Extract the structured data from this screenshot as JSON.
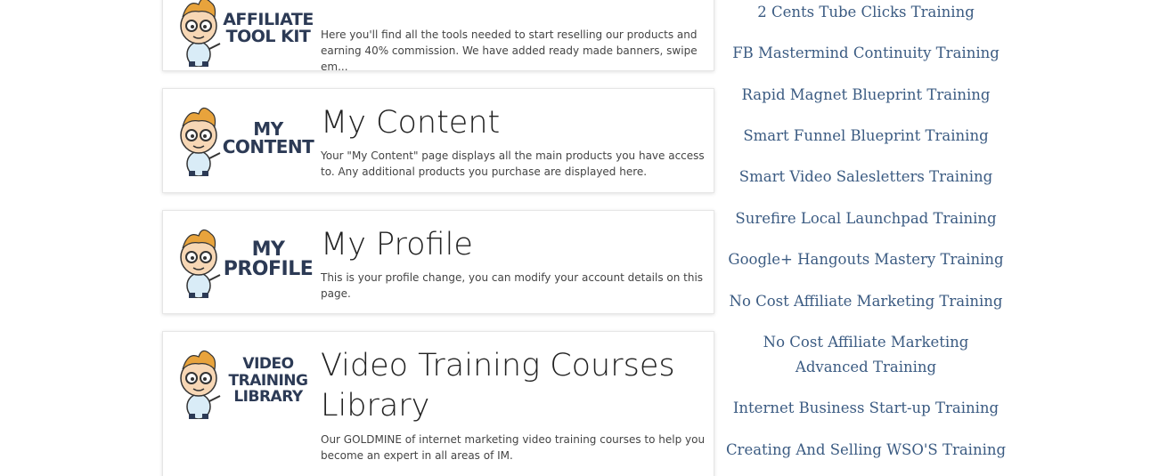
{
  "cards": [
    {
      "logo_lines": [
        "AFFILIATE",
        "TOOL KIT"
      ],
      "title": "Affiliate Tool Kit",
      "description": "Here you'll find all the tools needed to start reselling our products and earning 40% commission. We have added ready made banners, swipe em..."
    },
    {
      "logo_lines": [
        "MY",
        "CONTENT"
      ],
      "title": "My Content",
      "description": "Your \"My Content\" page displays all the main products you have access to. Any additional products you purchase are displayed here."
    },
    {
      "logo_lines": [
        "MY",
        "PROFILE"
      ],
      "title": "My Profile",
      "description": "This is your profile change, you can modify your account details on this page."
    },
    {
      "logo_lines": [
        "VIDEO",
        "TRAINING",
        "LIBRARY"
      ],
      "title": "Video Training Courses Library",
      "description": "Our GOLDMINE of internet marketing video training courses to help you become an expert in all areas of IM."
    }
  ],
  "training_links": [
    "2 Cents Tube Clicks Training",
    "FB Mastermind Continuity Training",
    "Rapid Magnet Blueprint Training",
    "Smart Funnel Blueprint Training",
    "Smart Video Salesletters Training",
    "Surefire Local Launchpad Training",
    "Google+ Hangouts Mastery Training",
    "No Cost Affiliate Marketing Training",
    "No Cost Affiliate Marketing Advanced Training",
    "Internet Business Start-up Training",
    "Creating And Selling WSO'S Training"
  ],
  "colors": {
    "link": "#3b5b82",
    "logo_text": "#2c3a55",
    "title": "#222222",
    "mascot_hair": "#e8a33c",
    "mascot_shirt": "#d9ecf7"
  }
}
